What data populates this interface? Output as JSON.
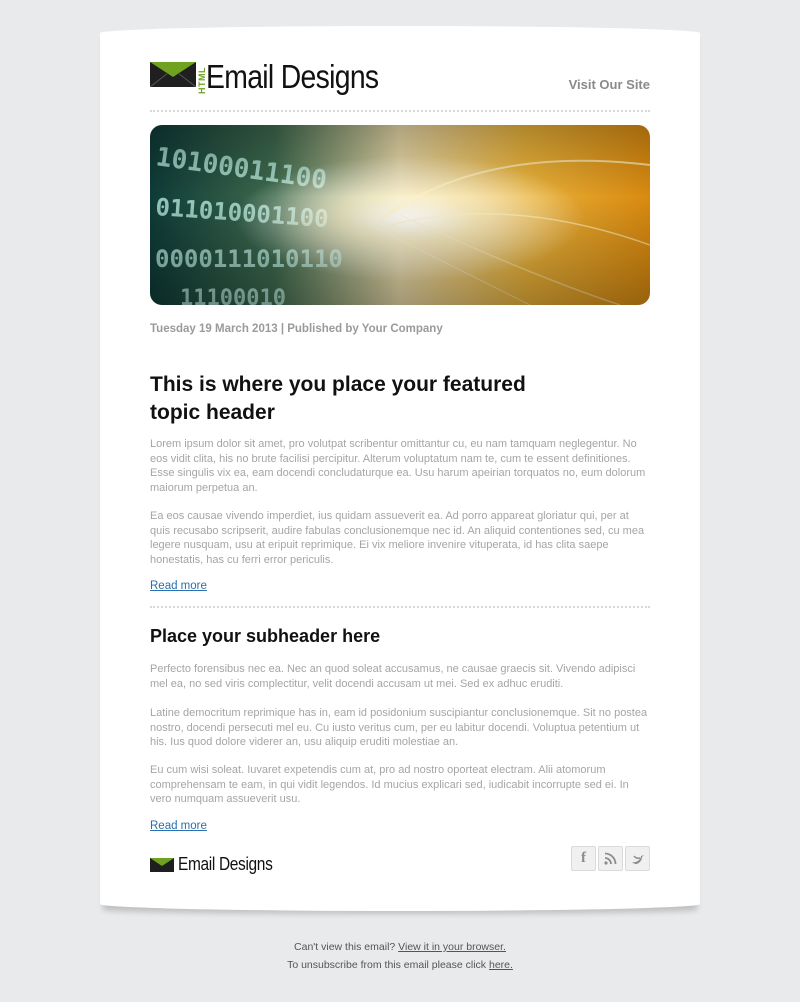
{
  "header": {
    "logo_tag": "HTML",
    "brand": "Email Designs",
    "visit_link": "Visit Our Site"
  },
  "meta": {
    "date_line": "Tuesday 19 March 2013 | Published by Your Company"
  },
  "featured": {
    "title": "This is where you place your featured topic header",
    "paragraphs": [
      "Lorem ipsum dolor sit amet, pro volutpat scribentur omittantur cu, eu nam tamquam neglegentur. No eos vidit clita, his no brute facilisi percipitur. Alterum voluptatum nam te, cum te essent definitiones. Esse singulis vix ea, eam docendi concludaturque ea. Usu harum apeirian torquatos no, eum dolorum maiorum perpetua an.",
      "Ea eos causae vivendo imperdiet, ius quidam assueverit ea. Ad porro appareat gloriatur qui, per at quis recusabo scripserit, audire fabulas conclusionemque nec id. An aliquid contentiones sed, cu mea legere nusquam, usu at eripuit reprimique. Ei vix meliore invenire vituperata, id has clita saepe honestatis, has cu ferri error periculis."
    ],
    "read_more": "Read more"
  },
  "secondary": {
    "title": "Place your subheader here",
    "paragraphs": [
      "Perfecto forensibus nec ea. Nec an quod soleat accusamus, ne causae graecis sit. Vivendo adipisci mel ea, no sed viris complectitur, velit docendi accusam ut mei. Sed ex adhuc eruditi.",
      "Latine democritum reprimique has in, eam id posidonium suscipiantur conclusionemque. Sit no postea nostro, docendi persecuti mel eu. Cu iusto veritus cum, per eu labitur docendi. Voluptua petentium ut his. Ius quod dolore viderer an, usu aliquip eruditi molestiae an.",
      "Eu cum wisi soleat. Iuvaret expetendis cum at, pro ad nostro oporteat electram. Alii atomorum comprehensam te eam, in qui vidit legendos. Id mucius explicari sed, iudicabit incorrupte sed ei. In vero numquam assueverit usu."
    ],
    "read_more": "Read more"
  },
  "footer_card": {
    "brand": "Email Designs",
    "social": [
      {
        "icon": "facebook-icon",
        "glyph": "f"
      },
      {
        "icon": "rss-icon",
        "glyph": "≋"
      },
      {
        "icon": "twitter-icon",
        "glyph": "➤"
      }
    ]
  },
  "footer": {
    "line1_text": "Can't view this email? ",
    "line1_link": "View it in your browser.",
    "line2_text": "To unsubscribe from this email please click ",
    "line2_link": "here."
  },
  "colors": {
    "accent_green": "#6ea21f",
    "link_blue": "#2a6fb0",
    "background": "#e9eaec"
  }
}
